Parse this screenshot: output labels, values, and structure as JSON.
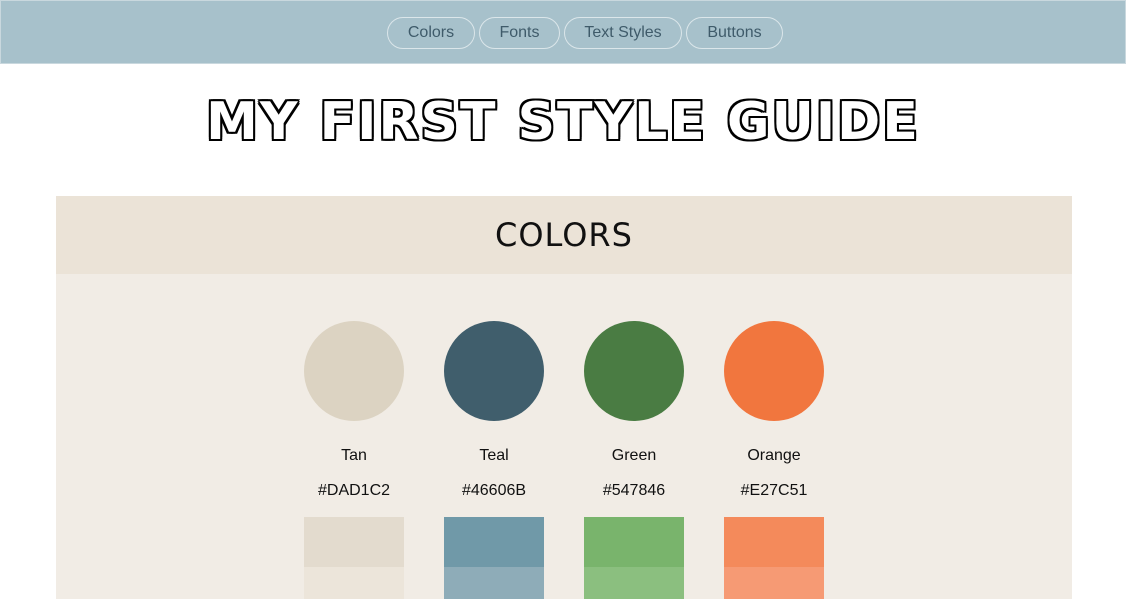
{
  "nav": {
    "items": [
      {
        "label": "Colors"
      },
      {
        "label": "Fonts"
      },
      {
        "label": "Text Styles"
      },
      {
        "label": "Buttons"
      }
    ]
  },
  "page": {
    "title": "My First Style Guide"
  },
  "colors_section": {
    "title": "COLORS",
    "swatches": [
      {
        "name": "Tan",
        "hex": "#DAD1C2",
        "circle": "#dcd3c2",
        "tint1": "#e3dbce",
        "tint2": "#ece5da"
      },
      {
        "name": "Teal",
        "hex": "#46606B",
        "circle": "#405e6c",
        "tint1": "#7099a8",
        "tint2": "#8eacb8"
      },
      {
        "name": "Green",
        "hex": "#547846",
        "circle": "#4a7c43",
        "tint1": "#79b46c",
        "tint2": "#8bbf7f"
      },
      {
        "name": "Orange",
        "hex": "#E27C51",
        "circle": "#f1763e",
        "tint1": "#f48a5b",
        "tint2": "#f69a74"
      }
    ]
  }
}
